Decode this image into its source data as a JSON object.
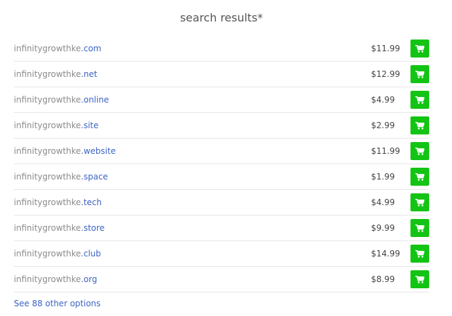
{
  "title": "search results*",
  "results": [
    {
      "name": "infinitygrowthke",
      "tld": ".com",
      "price": "$11.99"
    },
    {
      "name": "infinitygrowthke",
      "tld": ".net",
      "price": "$12.99"
    },
    {
      "name": "infinitygrowthke",
      "tld": ".online",
      "price": "$4.99"
    },
    {
      "name": "infinitygrowthke",
      "tld": ".site",
      "price": "$2.99"
    },
    {
      "name": "infinitygrowthke",
      "tld": ".website",
      "price": "$11.99"
    },
    {
      "name": "infinitygrowthke",
      "tld": ".space",
      "price": "$1.99"
    },
    {
      "name": "infinitygrowthke",
      "tld": ".tech",
      "price": "$4.99"
    },
    {
      "name": "infinitygrowthke",
      "tld": ".store",
      "price": "$9.99"
    },
    {
      "name": "infinitygrowthke",
      "tld": ".club",
      "price": "$14.99"
    },
    {
      "name": "infinitygrowthke",
      "tld": ".org",
      "price": "$8.99"
    }
  ],
  "more_link": "See 88 other options",
  "icons": {
    "add_to_cart": "shopping-cart-icon"
  },
  "colors": {
    "cart_button": "#14c414",
    "tld_link": "#3b63c4",
    "domain_base": "#8a8a8a"
  }
}
